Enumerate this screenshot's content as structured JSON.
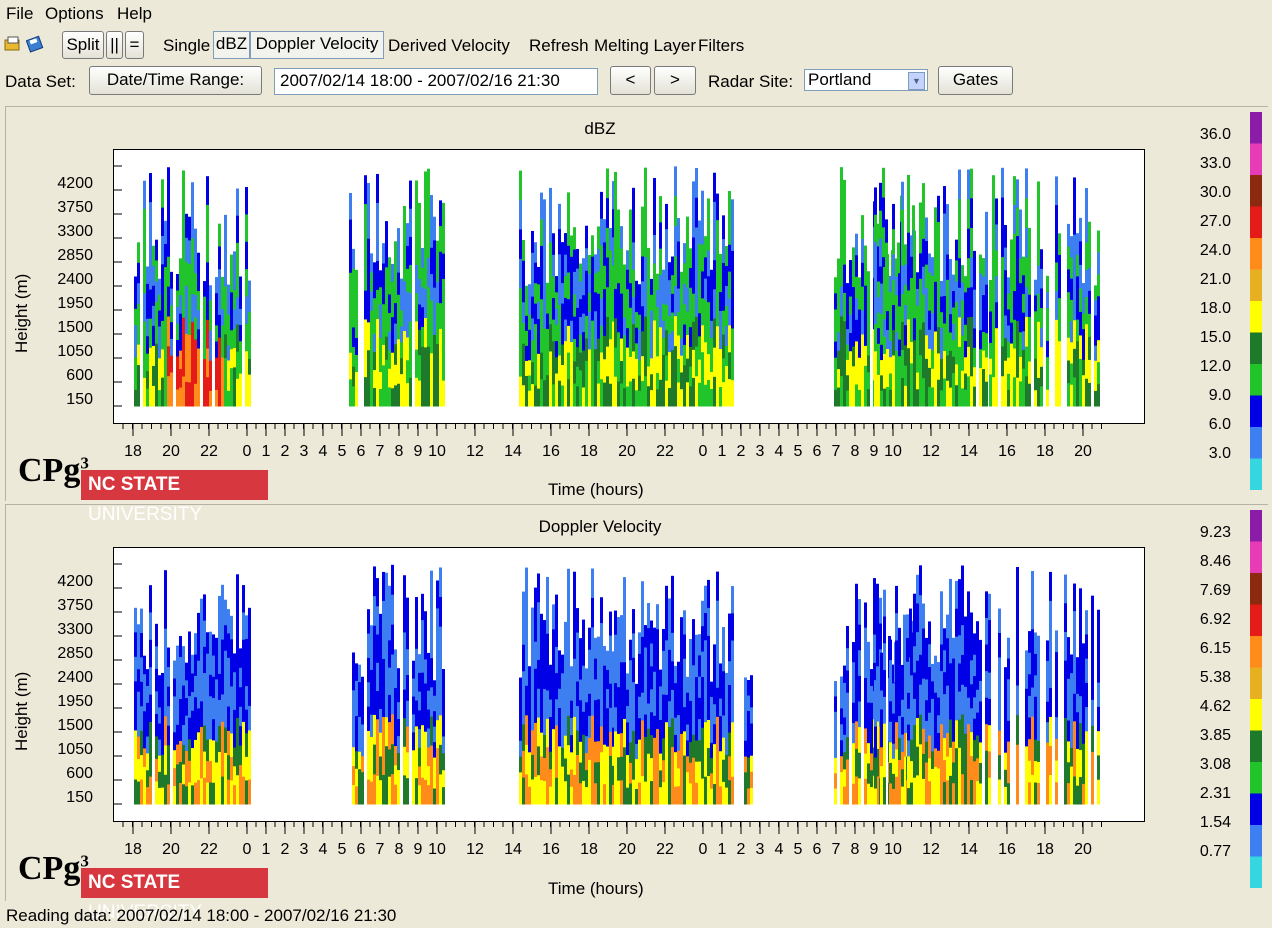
{
  "menu": {
    "file": "File",
    "options": "Options",
    "help": "Help"
  },
  "toolbar": {
    "open_icon": "open-folder-icon",
    "save_icon": "save-disk-icon",
    "split": "Split",
    "vertical": "||",
    "horizontal": "=",
    "single": "Single",
    "dbz": "dBZ",
    "doppler": "Doppler Velocity",
    "derived": "Derived Velocity",
    "refresh": "Refresh",
    "melting": "Melting Layer",
    "filters": "Filters"
  },
  "dataset": {
    "label": "Data Set:",
    "range_button": "Date/Time Range:",
    "range_value": "2007/02/14 18:00 - 2007/02/16 21:30",
    "prev": "<",
    "next": ">",
    "site_label": "Radar Site:",
    "site": "Portland",
    "gates": "Gates"
  },
  "plots": [
    {
      "title": "dBZ",
      "ylabel": "Height (m)",
      "xlabel": "Time (hours)",
      "yticks": [
        "4200",
        "3750",
        "3300",
        "2850",
        "2400",
        "1950",
        "1500",
        "1050",
        "600",
        "150"
      ],
      "colorbar": [
        "36.0",
        "33.0",
        "30.0",
        "27.0",
        "24.0",
        "21.0",
        "18.0",
        "15.0",
        "12.0",
        "9.0",
        "6.0",
        "3.0"
      ]
    },
    {
      "title": "Doppler Velocity",
      "ylabel": "Height (m)",
      "xlabel": "Time (hours)",
      "yticks": [
        "4200",
        "3750",
        "3300",
        "2850",
        "2400",
        "1950",
        "1500",
        "1050",
        "600",
        "150"
      ],
      "colorbar": [
        "9.23",
        "8.46",
        "7.69",
        "6.92",
        "6.15",
        "5.38",
        "4.62",
        "3.85",
        "3.08",
        "2.31",
        "1.54",
        "0.77"
      ]
    }
  ],
  "xticks": [
    "18",
    "20",
    "22",
    "0",
    "1",
    "2",
    "3",
    "4",
    "5",
    "6",
    "7",
    "8",
    "9",
    "10",
    "12",
    "14",
    "16",
    "18",
    "20",
    "22",
    "0",
    "1",
    "2",
    "3",
    "4",
    "5",
    "6",
    "7",
    "8",
    "9",
    "10",
    "12",
    "14",
    "16",
    "18",
    "20"
  ],
  "logo": {
    "cp": "CPg",
    "cp_sup": "3",
    "ncsu_bold": "NC STATE",
    "ncsu_light": " UNIVERSITY"
  },
  "status": "Reading data: 2007/02/14 18:00 - 2007/02/16 21:30",
  "colors": {
    "scale": [
      "#8a1ca8",
      "#e83cb6",
      "#8b2a0e",
      "#e41b17",
      "#ff8c1a",
      "#e6b020",
      "#ffff00",
      "#1e7a2a",
      "#21c42b",
      "#0000e6",
      "#3d7ff0",
      "#35d6e0"
    ]
  }
}
